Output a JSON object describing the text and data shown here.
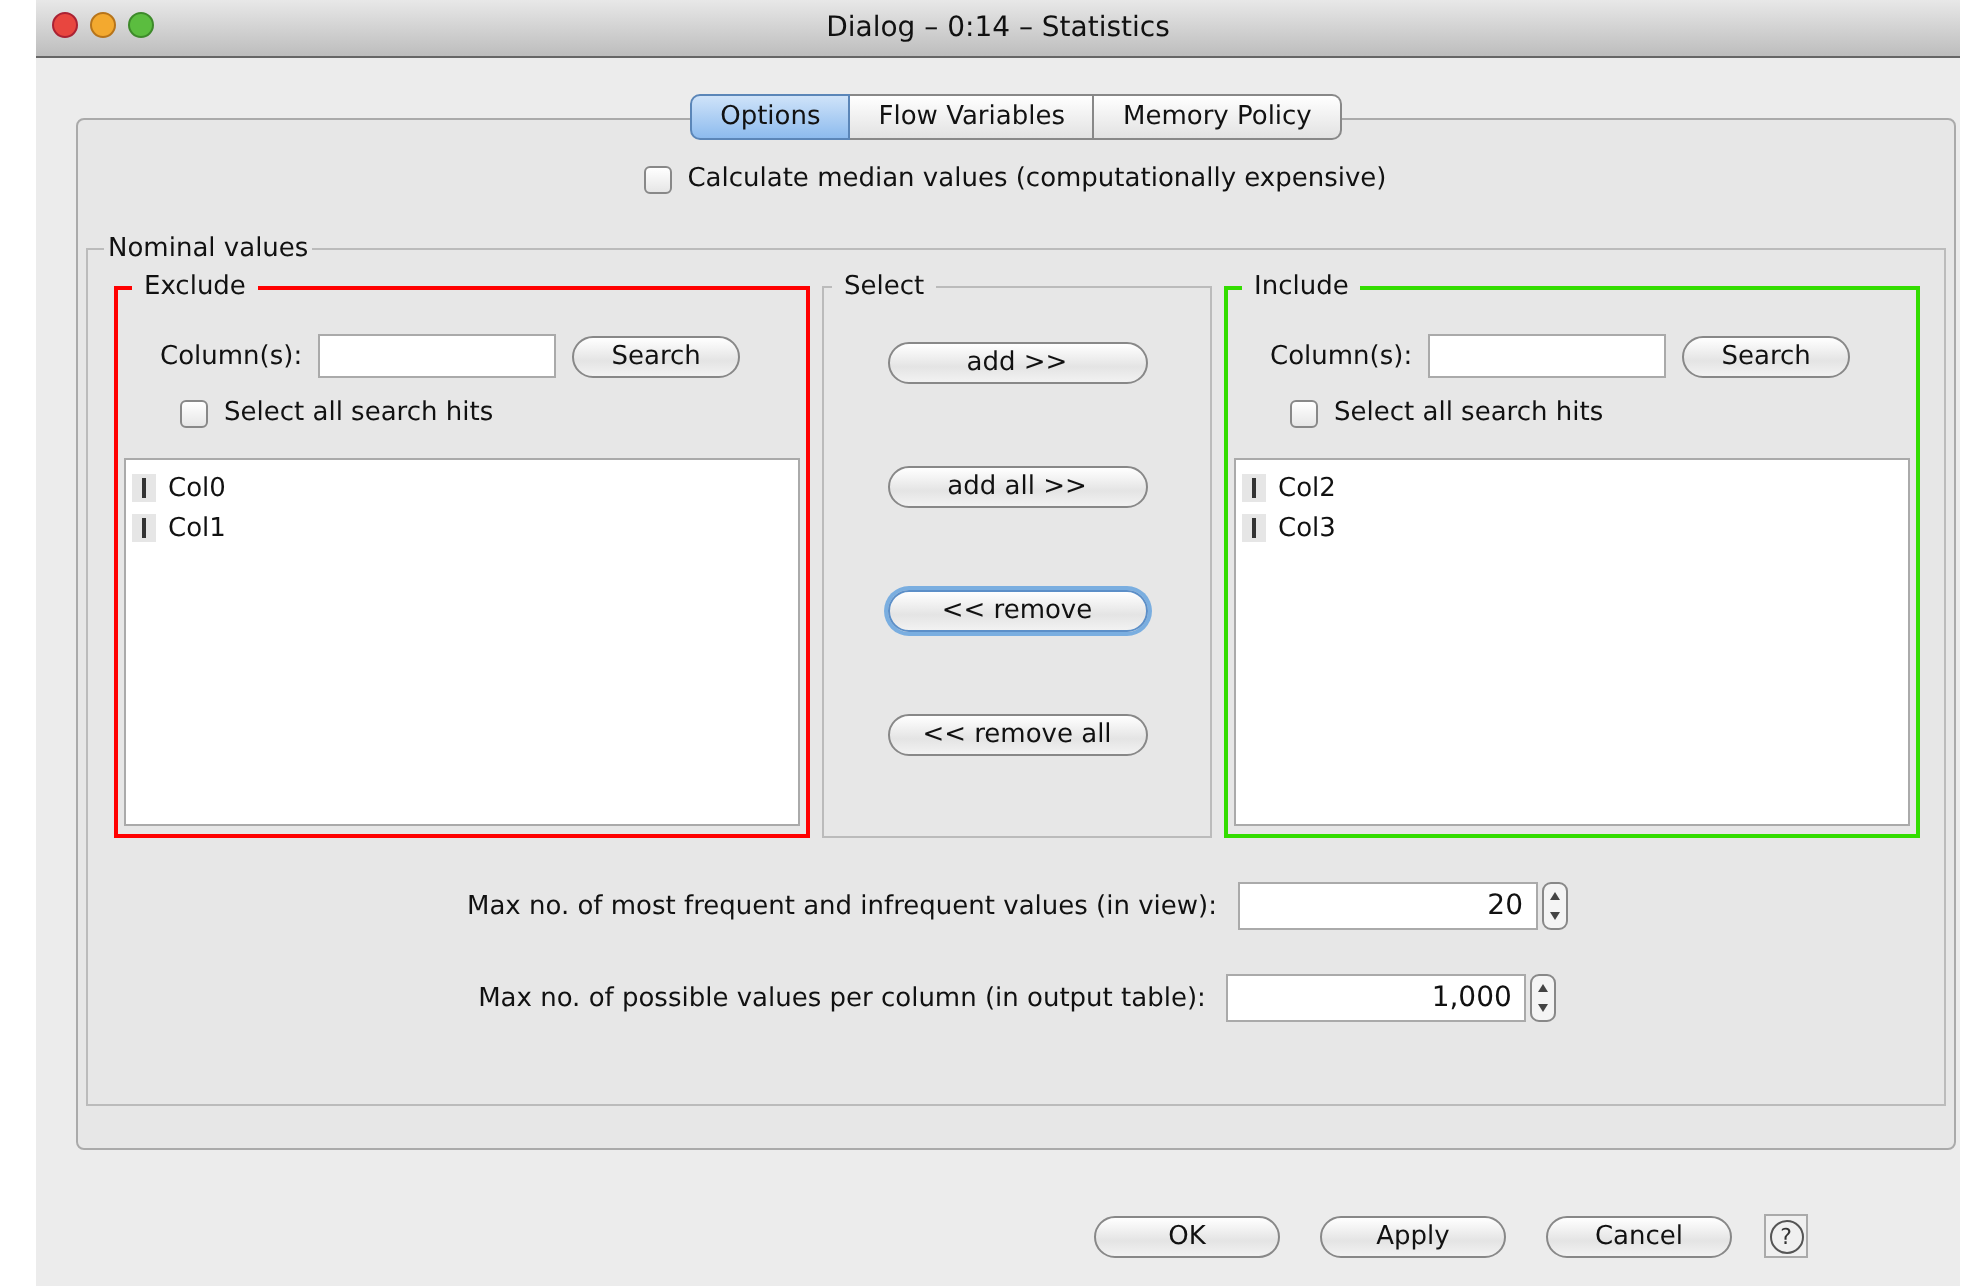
{
  "window": {
    "title": "Dialog – 0:14 – Statistics"
  },
  "tabs": [
    {
      "label": "Options",
      "selected": true
    },
    {
      "label": "Flow Variables",
      "selected": false
    },
    {
      "label": "Memory Policy",
      "selected": false
    }
  ],
  "median_checkbox": {
    "label": "Calculate median values (computationally expensive)",
    "checked": false
  },
  "nominal_values": {
    "title": "Nominal values",
    "exclude": {
      "title": "Exclude",
      "color": "#ff0000",
      "search_label": "Column(s):",
      "search_button": "Search",
      "select_all": {
        "label": "Select all search hits",
        "checked": false
      },
      "columns": [
        "Col0",
        "Col1"
      ]
    },
    "select": {
      "title": "Select",
      "buttons": [
        {
          "label": "add >>",
          "focused": false
        },
        {
          "label": "add all >>",
          "focused": false
        },
        {
          "label": "<< remove",
          "focused": true
        },
        {
          "label": "<< remove all",
          "focused": false
        }
      ]
    },
    "include": {
      "title": "Include",
      "color": "#33dd00",
      "search_label": "Column(s):",
      "search_button": "Search",
      "select_all": {
        "label": "Select all search hits",
        "checked": false
      },
      "columns": [
        "Col2",
        "Col3"
      ]
    },
    "spinners": [
      {
        "label": "Max no. of most frequent and infrequent values (in view):",
        "value": "20"
      },
      {
        "label": "Max no. of possible values per column (in output table):",
        "value": "1,000"
      }
    ]
  },
  "buttons": [
    "OK",
    "Apply",
    "Cancel"
  ],
  "help": "?"
}
